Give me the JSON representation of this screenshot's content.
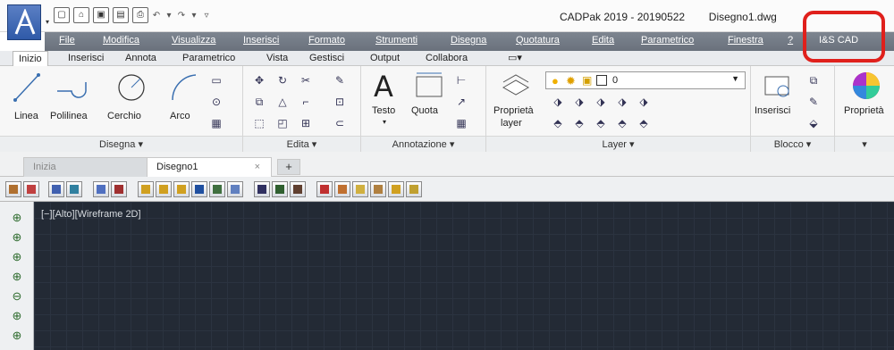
{
  "titlebar": {
    "app_title": "CADPak 2019 - 20190522",
    "document": "Disegno1.dwg"
  },
  "menu": [
    "File",
    "Modifica",
    "Visualizza",
    "Inserisci",
    "Formato",
    "Strumenti",
    "Disegna",
    "Quotatura",
    "Edita",
    "Parametrico",
    "Finestra",
    "?",
    "I&S CAD"
  ],
  "ribbon_tabs": [
    "Inizio",
    "Inserisci",
    "Annota",
    "Parametrico",
    "Vista",
    "Gestisci",
    "Output",
    "Collabora"
  ],
  "active_tab": "Inizio",
  "panels": {
    "draw": {
      "title": "Disegna ▾",
      "tools": [
        "Linea",
        "Polilinea",
        "Cerchio",
        "Arco"
      ]
    },
    "edit": {
      "title": "Edita ▾"
    },
    "annotation": {
      "title": "Annotazione ▾",
      "tools": [
        "Testo",
        "Quota"
      ]
    },
    "layer": {
      "title": "Layer ▾",
      "tool_line1": "Proprietà",
      "tool_line2": "layer",
      "current_layer": "0"
    },
    "block": {
      "title": "Blocco ▾",
      "tool": "Inserisci"
    },
    "properties": {
      "tool": "Proprietà",
      "title": "▾"
    }
  },
  "file_tabs": {
    "start": "Inizia",
    "current": "Disegno1",
    "close": "×",
    "add": "+"
  },
  "viewport_label": "[−][Alto][Wireframe 2D]",
  "colors": {
    "highlight": "#e0201c",
    "canvas_bg": "#232a35",
    "menubar_bg": "#737a85"
  }
}
